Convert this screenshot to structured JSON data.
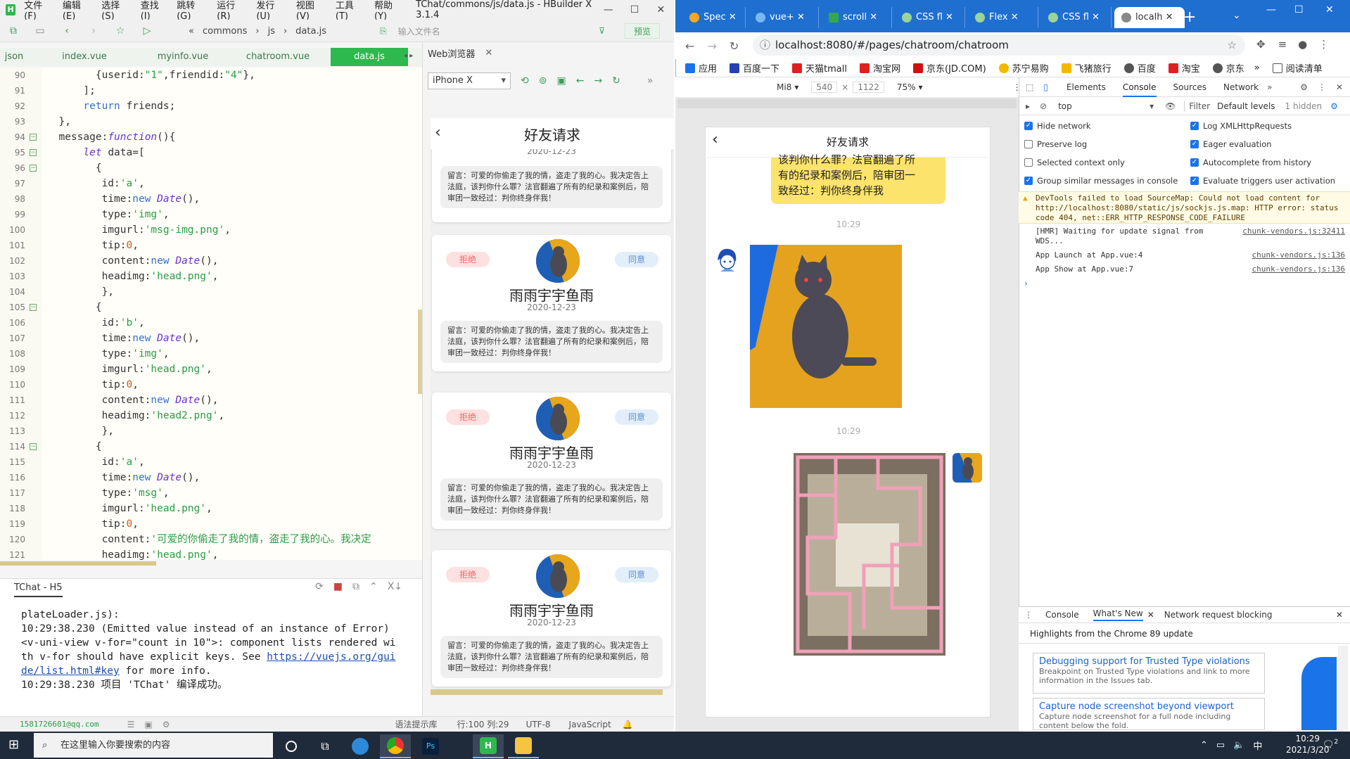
{
  "hbuilder": {
    "logo": "H",
    "menus": [
      "文件(F)",
      "编辑(E)",
      "选择(S)",
      "查找(I)",
      "跳转(G)",
      "运行(R)",
      "发行(U)",
      "视图(V)",
      "工具(T)",
      "帮助(Y)"
    ],
    "title": "TChat/commons/js/data.js - HBuilder X 3.1.4",
    "breadcrumb": [
      "commons",
      "js",
      "data.js"
    ],
    "file_search_placeholder": "输入文件名",
    "preview_label": "预览",
    "tabs": [
      "json",
      "index.vue",
      "myinfo.vue",
      "chatroom.vue",
      "data.js"
    ],
    "active_tab": "data.js",
    "line_numbers": [
      "90",
      "91",
      "92",
      "93",
      "94",
      "95",
      "96",
      "97",
      "98",
      "99",
      "100",
      "101",
      "102",
      "103",
      "104",
      "105",
      "106",
      "107",
      "108",
      "109",
      "110",
      "111",
      "112",
      "113",
      "114",
      "115",
      "116",
      "117",
      "118",
      "119",
      "120",
      "121"
    ],
    "console": {
      "title": "TChat - H5",
      "lines": [
        "plateLoader.js):",
        "10:29:38.230 (Emitted value instead of an instance of Error)",
        "<v-uni-view v-for=\"count in 10\">: component lists rendered wi",
        "th v-for should have explicit keys. See ",
        "https://vuejs.org/gui",
        "de/list.html#key",
        " for more info.",
        "10:29:38.230 项目 'TChat' 编译成功。"
      ]
    },
    "status": {
      "email": "1581726601@qq.com",
      "hint": "语法提示库",
      "position": "行:100  列:29",
      "encoding": "UTF-8",
      "language": "JavaScript"
    }
  },
  "web_browser": {
    "tab_label": "Web浏览器",
    "device": "iPhone X",
    "page_title": "好友请求",
    "top_date": "2020-12-23",
    "top_note": "留言：可爱的你偷走了我的情，盗走了我的心。我决定告上法庭，该判你什么罪？法官翻遍了所有的纪录和案例后，陪审团一致经过：判你终身伴我！",
    "cards": [
      {
        "reject": "拒绝",
        "agree": "同意",
        "name": "雨雨宇宇鱼雨",
        "date": "2020-12-23",
        "note": "留言：可爱的你偷走了我的情，盗走了我的心。我决定告上法庭，该判你什么罪？法官翻遍了所有的纪录和案例后，陪审团一致经过：判你终身伴我！"
      },
      {
        "reject": "拒绝",
        "agree": "同意",
        "name": "雨雨宇宇鱼雨",
        "date": "2020-12-23",
        "note": "留言：可爱的你偷走了我的情，盗走了我的心。我决定告上法庭，该判你什么罪？法官翻遍了所有的纪录和案例后，陪审团一致经过：判你终身伴我！"
      },
      {
        "reject": "拒绝",
        "agree": "同意",
        "name": "雨雨宇宇鱼雨",
        "date": "2020-12-23",
        "note": "留言：可爱的你偷走了我的情，盗走了我的心。我决定告上法庭，该判你什么罪？法官翻遍了所有的纪录和案例后，陪审团一致经过：判你终身伴我！"
      }
    ]
  },
  "chrome": {
    "tabs": [
      "Spec",
      "vue+",
      "scroll",
      "CSS fl",
      "Flex",
      "CSS fl",
      "localh"
    ],
    "new_tab": "+",
    "url": "localhost:8080/#/pages/chatroom/chatroom",
    "bookmarks": [
      "应用",
      "百度一下",
      "天猫tmall",
      "淘宝网",
      "京东(JD.COM)",
      "苏宁易购",
      "飞猪旅行",
      "百度",
      "淘宝",
      "京东"
    ],
    "reading_list": "阅读清单",
    "emulation": {
      "device": "Mi8",
      "width": "540",
      "height": "1122",
      "zoom": "75%"
    },
    "chat": {
      "title": "好友请求",
      "bubble_text": [
        "该判你什么罪？法官翻遍了所",
        "有的纪录和案例后，陪审团一",
        "致经过：判你终身伴我"
      ],
      "time1": "10:29",
      "time2": "10:29"
    },
    "devtools": {
      "tabs": [
        "Elements",
        "Console",
        "Sources",
        "Network"
      ],
      "active_tab": "Console",
      "context": "top",
      "filter_placeholder": "Filter",
      "levels": "Default levels",
      "hidden": "1 hidden",
      "settings": [
        {
          "label": "Hide network",
          "checked": true
        },
        {
          "label": "Log XMLHttpRequests",
          "checked": true
        },
        {
          "label": "Preserve log",
          "checked": false
        },
        {
          "label": "Eager evaluation",
          "checked": true
        },
        {
          "label": "Selected context only",
          "checked": false
        },
        {
          "label": "Autocomplete from history",
          "checked": true
        },
        {
          "label": "Group similar messages in console",
          "checked": true
        },
        {
          "label": "Evaluate triggers user activation",
          "checked": true
        }
      ],
      "warning": "DevTools failed to load SourceMap: Could not load content for http://localhost:8080/static/js/sockjs.js.map: HTTP error: status code 404, net::ERR_HTTP_RESPONSE_CODE_FAILURE",
      "logs": [
        {
          "msg": "[HMR] Waiting for update signal from WDS...",
          "src": "chunk-vendors.js:32411"
        },
        {
          "msg": "App Launch  at App.vue:4",
          "src": "chunk-vendors.js:136"
        },
        {
          "msg": "App Show  at App.vue:7",
          "src": "chunk-vendors.js:136"
        }
      ],
      "drawer_tabs": [
        "Console",
        "What's New",
        "Network request blocking"
      ],
      "highlights": "Highlights from the Chrome 89 update",
      "tips": [
        {
          "title": "Debugging support for Trusted Type violations",
          "desc": "Breakpoint on Trusted Type violations and link to more information in the Issues tab."
        },
        {
          "title": "Capture node screenshot beyond viewport",
          "desc": "Capture node screenshot for a full node including content below the fold."
        }
      ]
    }
  },
  "taskbar": {
    "search_placeholder": "在这里输入你要搜索的内容",
    "time": "10:29",
    "date": "2021/3/20",
    "ime": "中",
    "notif": "2"
  }
}
